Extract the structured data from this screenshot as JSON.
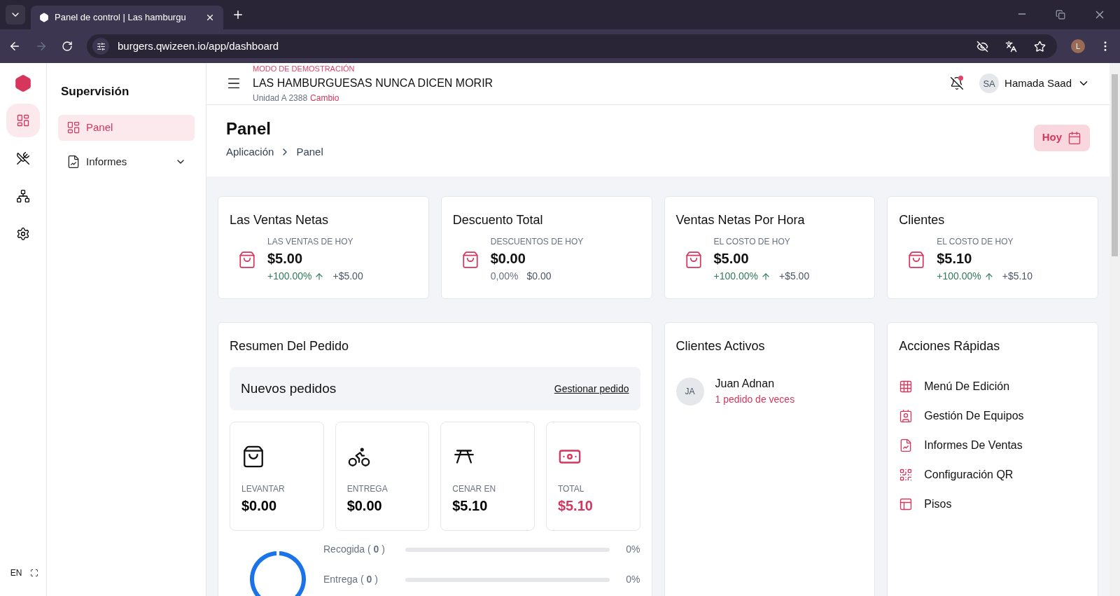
{
  "browser": {
    "tab_title": "Panel de control | Las hamburgu",
    "url": "burgers.qwizeen.io/app/dashboard",
    "profile_initial": "L"
  },
  "rail": {
    "items": [
      {
        "kind": "dashboard",
        "selected": true
      },
      {
        "kind": "menu",
        "selected": false
      },
      {
        "kind": "network",
        "selected": false
      },
      {
        "kind": "settings",
        "selected": false
      }
    ],
    "language": "EN"
  },
  "sidebar": {
    "title": "Supervisión",
    "items": [
      {
        "kind": "dashboard",
        "label": "Panel",
        "selected": true,
        "expandable": false
      },
      {
        "kind": "reports",
        "label": "Informes",
        "selected": false,
        "expandable": true
      }
    ]
  },
  "header": {
    "demo_label": "MODO DE DEMOSTRACIÓN",
    "store_name": "LAS HAMBURGUESAS NUNCA DICEN MORIR",
    "unit": "Unidad A 2388",
    "change_link": "Cambio",
    "notification_dot": true,
    "user_initials": "SA",
    "user_name": "Hamada Saad"
  },
  "page": {
    "title": "Panel",
    "breadcrumb": [
      "Aplicación",
      "Panel"
    ],
    "today_button": "Hoy"
  },
  "stats": [
    {
      "title": "Las Ventas Netas",
      "caption": "LAS VENTAS DE HOY",
      "value": "$5.00",
      "percent": "+100.00%",
      "amount": "+$5.00",
      "rising": true
    },
    {
      "title": "Descuento Total",
      "caption": "DESCUENTOS DE HOY",
      "value": "$0.00",
      "percent": "0,00%",
      "amount": "$0.00",
      "rising": false
    },
    {
      "title": "Ventas Netas Por Hora",
      "caption": "EL COSTO DE HOY",
      "value": "$5.00",
      "percent": "+100.00%",
      "amount": "+$5.00",
      "rising": true
    },
    {
      "title": "Clientes",
      "caption": "EL COSTO DE HOY",
      "value": "$5.10",
      "percent": "+100.00%",
      "amount": "+$5.10",
      "rising": true
    }
  ],
  "order_summary": {
    "title": "Resumen Del Pedido",
    "banner": {
      "title": "Nuevos pedidos",
      "link": "Gestionar pedido"
    },
    "tiles": [
      {
        "kind": "bag",
        "label": "LEVANTAR",
        "value": "$0.00",
        "accent": false
      },
      {
        "kind": "bike",
        "label": "ENTREGA",
        "value": "$0.00",
        "accent": false
      },
      {
        "kind": "table",
        "label": "CENAR EN",
        "value": "$5.10",
        "accent": false
      },
      {
        "kind": "cash",
        "label": "TOTAL",
        "value": "$5.10",
        "accent": true
      }
    ],
    "progress": [
      {
        "label": "Recogida ( **0** )",
        "level": 0,
        "reading": "0%"
      },
      {
        "label": "Entrega ( **0** )",
        "level": 0,
        "reading": "0%"
      }
    ]
  },
  "active_clients": {
    "title": "Clientes Activos",
    "clients": [
      {
        "initials": "JA",
        "name": "Juan Adnan",
        "orders": "1 pedido de veces"
      }
    ]
  },
  "quick_actions": {
    "title": "Acciones Rápidas",
    "items": [
      {
        "kind": "grid",
        "label": "Menú De Edición"
      },
      {
        "kind": "team",
        "label": "Gestión De Equipos"
      },
      {
        "kind": "report",
        "label": "Informes De Ventas"
      },
      {
        "kind": "qr",
        "label": "Configuración QR"
      },
      {
        "kind": "floor",
        "label": "Pisos"
      }
    ]
  }
}
